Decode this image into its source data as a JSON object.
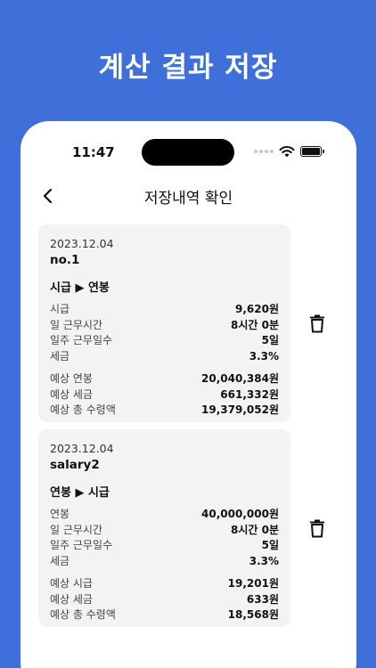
{
  "headline": "계산 결과 저장",
  "status": {
    "time": "11:47"
  },
  "nav": {
    "title": "저장내역 확인"
  },
  "records": [
    {
      "date": "2023.12.04",
      "name": "no.1",
      "conversion": "시급 ▶ 연봉",
      "inputs": [
        {
          "label": "시급",
          "value": "9,620원"
        },
        {
          "label": "일 근무시간",
          "value": "8시간 0분"
        },
        {
          "label": "일주 근무일수",
          "value": "5일"
        },
        {
          "label": "세금",
          "value": "3.3%"
        }
      ],
      "results": [
        {
          "label": "예상 연봉",
          "value": "20,040,384원"
        },
        {
          "label": "예상 세금",
          "value": "661,332원"
        },
        {
          "label": "예상 총 수령액",
          "value": "19,379,052원"
        }
      ]
    },
    {
      "date": "2023.12.04",
      "name": "salary2",
      "conversion": "연봉 ▶ 시급",
      "inputs": [
        {
          "label": "연봉",
          "value": "40,000,000원"
        },
        {
          "label": "일 근무시간",
          "value": "8시간 0분"
        },
        {
          "label": "일주 근무일수",
          "value": "5일"
        },
        {
          "label": "세금",
          "value": "3.3%"
        }
      ],
      "results": [
        {
          "label": "예상 시급",
          "value": "19,201원"
        },
        {
          "label": "예상 세금",
          "value": "633원"
        },
        {
          "label": "예상 총 수령액",
          "value": "18,568원"
        }
      ]
    }
  ],
  "icons": {
    "back": "chevron-left-icon",
    "delete": "trash-icon",
    "wifi": "wifi-icon",
    "battery": "battery-icon",
    "signal": "signal-icon"
  },
  "colors": {
    "background": "#3f6fd8",
    "card": "#f3f3f3"
  }
}
